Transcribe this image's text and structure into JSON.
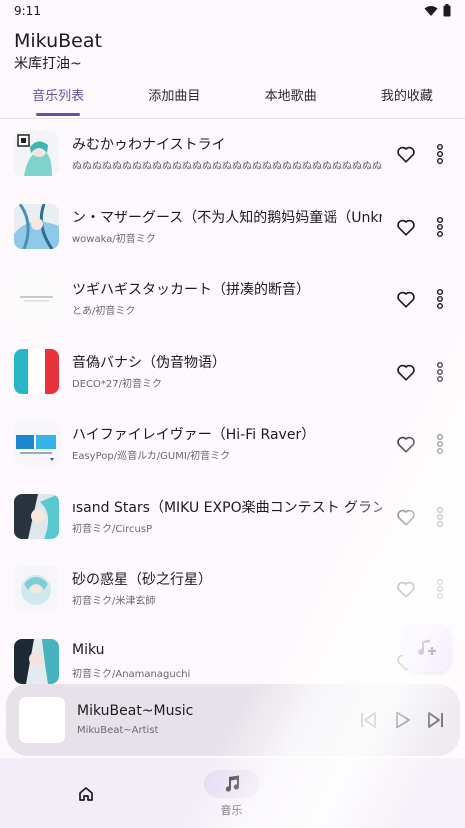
{
  "status_bar": {
    "time": "9:11"
  },
  "app": {
    "title": "MikuBeat",
    "subtitle": "米库打油~"
  },
  "tabs": [
    {
      "label": "音乐列表",
      "active": true
    },
    {
      "label": "添加曲目",
      "active": false
    },
    {
      "label": "本地歌曲",
      "active": false
    },
    {
      "label": "我的收藏",
      "active": false
    }
  ],
  "songs": [
    {
      "title": "みむかゥわナイストライ",
      "artist": "ぬぬぬぬぬぬぬぬぬぬぬぬぬぬぬぬぬぬぬぬぬぬぬぬぬぬぬぬぬぬぬぬぬぬぬ…"
    },
    {
      "title": "ン・マザーグース（不为人知的鹅妈妈童谣（Unknc",
      "artist": "wowaka/初音ミク"
    },
    {
      "title": "ツギハギスタッカート（拼凑的断音）",
      "artist": "とあ/初音ミク"
    },
    {
      "title": "音偽バナシ（伪音物语）",
      "artist": "DECO*27/初音ミク"
    },
    {
      "title": "ハイファイレイヴァー（Hi-Fi Raver）",
      "artist": "EasyPop/巡音ルカ/GUMI/初音ミク"
    },
    {
      "title": "ısand Stars（MIKU EXPO楽曲コンテスト グランプ",
      "artist": "初音ミク/CircusP"
    },
    {
      "title": "砂の惑星（砂之行星）",
      "artist": "初音ミク/米津玄師"
    },
    {
      "title": "Miku",
      "artist": "初音ミク/Anamanaguchi"
    }
  ],
  "player": {
    "title": "MikuBeat~Music",
    "artist": "MikuBeat~Artist"
  },
  "nav": {
    "home": "",
    "music": "音乐"
  },
  "colors": {
    "accent": "#6750a4",
    "background": "#fdf8fc",
    "player": "#e7e2ea",
    "fab": "#eaddff"
  },
  "icons": [
    "wifi-icon",
    "battery-icon",
    "heart-icon",
    "more-vert-icon",
    "add-music-icon",
    "skip-previous-icon",
    "play-icon",
    "skip-next-icon",
    "home-icon",
    "music-note-icon"
  ]
}
